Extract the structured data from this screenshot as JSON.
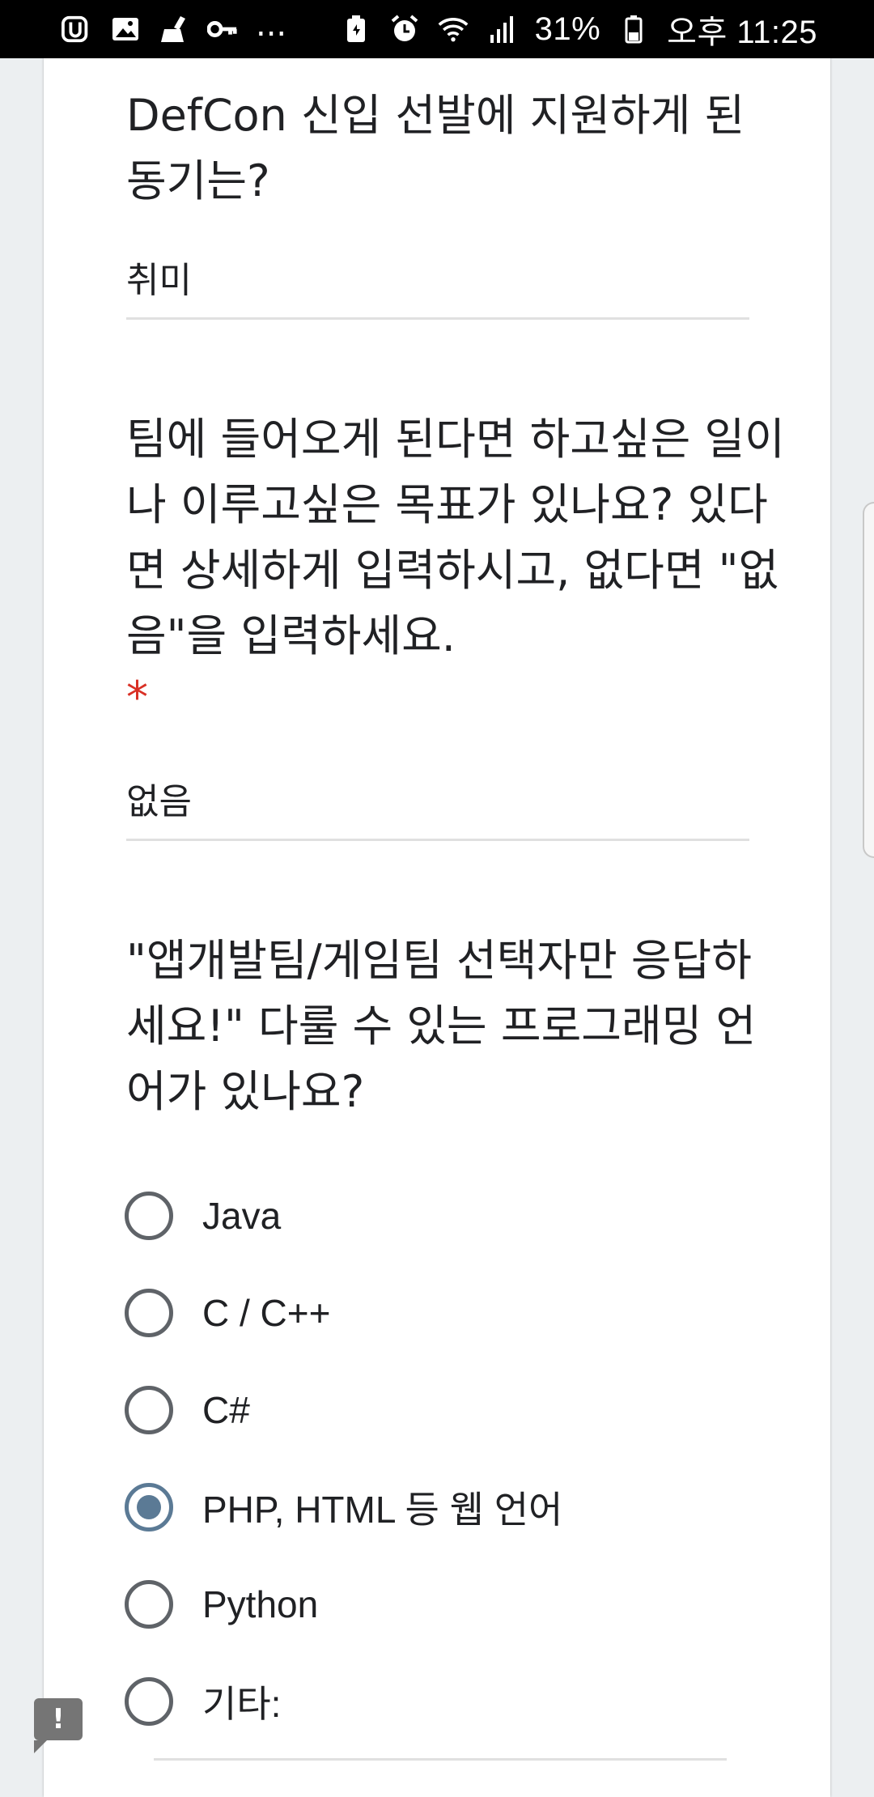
{
  "status_bar": {
    "battery_percent": "31%",
    "time": "오후 11:25",
    "icons": [
      "app-icon",
      "gallery-icon",
      "broom-icon",
      "key-icon",
      "battery-saver-icon",
      "alarm-icon",
      "wifi-icon",
      "signal-icon",
      "battery-icon"
    ],
    "more": "..."
  },
  "questions": [
    {
      "title": "DefCon 신입 선발에 지원하게 된 동기는?",
      "answer": "취미"
    },
    {
      "title": "팀에 들어오게 된다면 하고싶은 일이나 이루고싶은 목표가 있나요? 있다면 상세하게 입력하시고, 없다면 \"없음\"을 입력하세요.",
      "required": "*",
      "answer": "없음"
    },
    {
      "title": "\"앱개발팀/게임팀 선택자만 응답하세요!\" 다룰 수 있는 프로그래밍 언어가 있나요?",
      "options": [
        "Java",
        "C / C++",
        "C#",
        "PHP, HTML 등 웹 언어",
        "Python",
        "기타:"
      ],
      "selected": "PHP, HTML 등 웹 언어"
    }
  ],
  "feedback_button": "!",
  "colors": {
    "accent": "#5b7a95",
    "required": "#d93025",
    "background": "#eceff1"
  }
}
